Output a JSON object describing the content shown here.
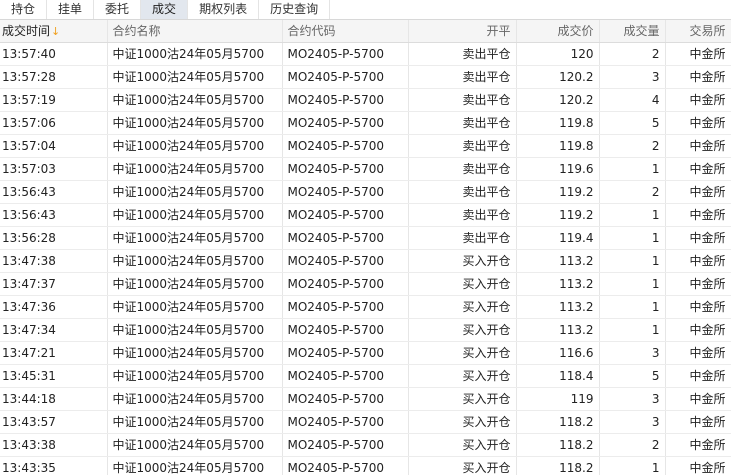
{
  "tabs": [
    {
      "label": "持仓",
      "active": false
    },
    {
      "label": "挂单",
      "active": false
    },
    {
      "label": "委托",
      "active": false
    },
    {
      "label": "成交",
      "active": true
    },
    {
      "label": "期权列表",
      "active": false
    },
    {
      "label": "历史查询",
      "active": false
    }
  ],
  "columns": [
    "成交时间",
    "合约名称",
    "合约代码",
    "开平",
    "成交价",
    "成交量",
    "交易所"
  ],
  "sort_indicator": "↓",
  "colors": {
    "sell": "#3f7fc9",
    "buy": "#e03a3a",
    "active_tab": "#e2e7ee",
    "sort_arrow": "#f0a020"
  },
  "rows": [
    {
      "time": "13:57:40",
      "name": "中证1000沽24年05月5700",
      "code": "MO2405-P-5700",
      "action": "卖出平仓",
      "side": "sell",
      "price": "120",
      "volume": "2",
      "exchange": "中金所"
    },
    {
      "time": "13:57:28",
      "name": "中证1000沽24年05月5700",
      "code": "MO2405-P-5700",
      "action": "卖出平仓",
      "side": "sell",
      "price": "120.2",
      "volume": "3",
      "exchange": "中金所"
    },
    {
      "time": "13:57:19",
      "name": "中证1000沽24年05月5700",
      "code": "MO2405-P-5700",
      "action": "卖出平仓",
      "side": "sell",
      "price": "120.2",
      "volume": "4",
      "exchange": "中金所"
    },
    {
      "time": "13:57:06",
      "name": "中证1000沽24年05月5700",
      "code": "MO2405-P-5700",
      "action": "卖出平仓",
      "side": "sell",
      "price": "119.8",
      "volume": "5",
      "exchange": "中金所"
    },
    {
      "time": "13:57:04",
      "name": "中证1000沽24年05月5700",
      "code": "MO2405-P-5700",
      "action": "卖出平仓",
      "side": "sell",
      "price": "119.8",
      "volume": "2",
      "exchange": "中金所"
    },
    {
      "time": "13:57:03",
      "name": "中证1000沽24年05月5700",
      "code": "MO2405-P-5700",
      "action": "卖出平仓",
      "side": "sell",
      "price": "119.6",
      "volume": "1",
      "exchange": "中金所"
    },
    {
      "time": "13:56:43",
      "name": "中证1000沽24年05月5700",
      "code": "MO2405-P-5700",
      "action": "卖出平仓",
      "side": "sell",
      "price": "119.2",
      "volume": "2",
      "exchange": "中金所"
    },
    {
      "time": "13:56:43",
      "name": "中证1000沽24年05月5700",
      "code": "MO2405-P-5700",
      "action": "卖出平仓",
      "side": "sell",
      "price": "119.2",
      "volume": "1",
      "exchange": "中金所"
    },
    {
      "time": "13:56:28",
      "name": "中证1000沽24年05月5700",
      "code": "MO2405-P-5700",
      "action": "卖出平仓",
      "side": "sell",
      "price": "119.4",
      "volume": "1",
      "exchange": "中金所"
    },
    {
      "time": "13:47:38",
      "name": "中证1000沽24年05月5700",
      "code": "MO2405-P-5700",
      "action": "买入开仓",
      "side": "buy",
      "price": "113.2",
      "volume": "1",
      "exchange": "中金所"
    },
    {
      "time": "13:47:37",
      "name": "中证1000沽24年05月5700",
      "code": "MO2405-P-5700",
      "action": "买入开仓",
      "side": "buy",
      "price": "113.2",
      "volume": "1",
      "exchange": "中金所"
    },
    {
      "time": "13:47:36",
      "name": "中证1000沽24年05月5700",
      "code": "MO2405-P-5700",
      "action": "买入开仓",
      "side": "buy",
      "price": "113.2",
      "volume": "1",
      "exchange": "中金所"
    },
    {
      "time": "13:47:34",
      "name": "中证1000沽24年05月5700",
      "code": "MO2405-P-5700",
      "action": "买入开仓",
      "side": "buy",
      "price": "113.2",
      "volume": "1",
      "exchange": "中金所"
    },
    {
      "time": "13:47:21",
      "name": "中证1000沽24年05月5700",
      "code": "MO2405-P-5700",
      "action": "买入开仓",
      "side": "buy",
      "price": "116.6",
      "volume": "3",
      "exchange": "中金所"
    },
    {
      "time": "13:45:31",
      "name": "中证1000沽24年05月5700",
      "code": "MO2405-P-5700",
      "action": "买入开仓",
      "side": "buy",
      "price": "118.4",
      "volume": "5",
      "exchange": "中金所"
    },
    {
      "time": "13:44:18",
      "name": "中证1000沽24年05月5700",
      "code": "MO2405-P-5700",
      "action": "买入开仓",
      "side": "buy",
      "price": "119",
      "volume": "3",
      "exchange": "中金所"
    },
    {
      "time": "13:43:57",
      "name": "中证1000沽24年05月5700",
      "code": "MO2405-P-5700",
      "action": "买入开仓",
      "side": "buy",
      "price": "118.2",
      "volume": "3",
      "exchange": "中金所"
    },
    {
      "time": "13:43:38",
      "name": "中证1000沽24年05月5700",
      "code": "MO2405-P-5700",
      "action": "买入开仓",
      "side": "buy",
      "price": "118.2",
      "volume": "2",
      "exchange": "中金所"
    },
    {
      "time": "13:43:35",
      "name": "中证1000沽24年05月5700",
      "code": "MO2405-P-5700",
      "action": "买入开仓",
      "side": "buy",
      "price": "118.2",
      "volume": "1",
      "exchange": "中金所"
    }
  ]
}
